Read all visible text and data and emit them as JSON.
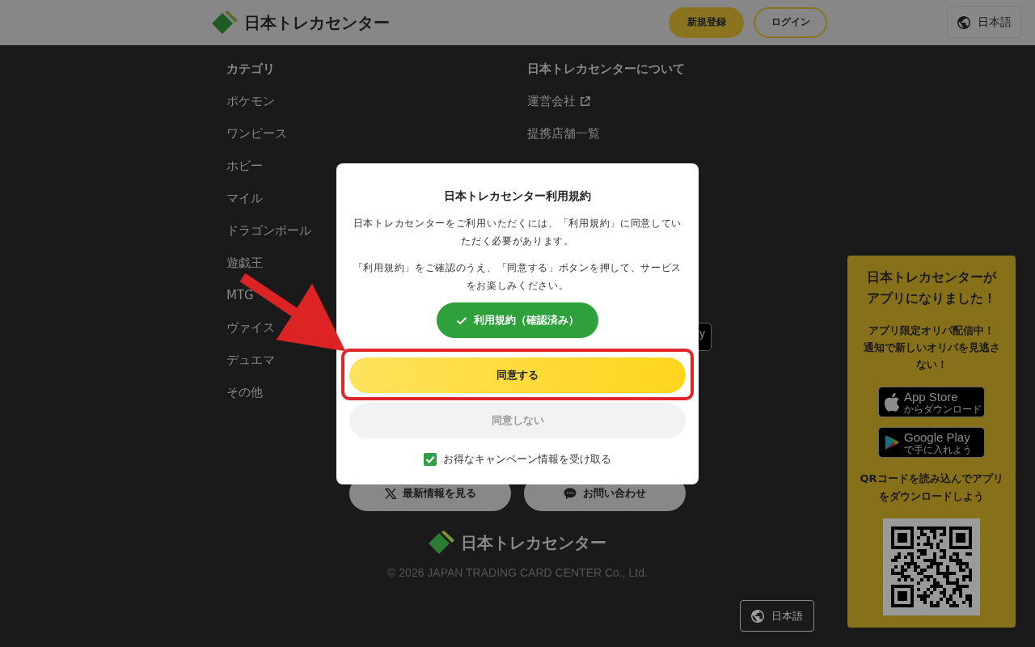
{
  "header": {
    "logo": {
      "text": "日本トレカセンター"
    },
    "buttons": [
      {
        "label": "新規登録",
        "kind": "primary"
      },
      {
        "label": "ログイン",
        "kind": "outline"
      }
    ],
    "language": "日本語"
  },
  "footer": {
    "columns": [
      {
        "title": "カテゴリ",
        "links": [
          {
            "label": "ポケモン",
            "external": false
          },
          {
            "label": "ワンピース",
            "external": false
          },
          {
            "label": "ホビー",
            "external": false
          },
          {
            "label": "マイル",
            "external": false
          },
          {
            "label": "ドラゴンボール",
            "external": false
          },
          {
            "label": "遊戯王",
            "external": false
          },
          {
            "label": "MTG",
            "external": false
          },
          {
            "label": "ヴァイス",
            "external": false
          },
          {
            "label": "デュエマ",
            "external": false
          },
          {
            "label": "その他",
            "external": false
          }
        ]
      },
      {
        "title": "日本トレカセンターについて",
        "links": [
          {
            "label": "運営会社",
            "external": true
          },
          {
            "label": "提携店舗一覧",
            "external": false
          }
        ]
      }
    ],
    "partial_store_badge": "y",
    "actions": [
      {
        "label": "最新情報を見る",
        "kind": "x"
      },
      {
        "label": "お問い合わせ",
        "kind": "chat"
      }
    ],
    "logo": {
      "text": "日本トレカセンター"
    },
    "copyright": "© 2026 JAPAN TRADING CARD CENTER Co., Ltd.",
    "language": "日本語"
  },
  "app_banner": {
    "title": "日本トレカセンターがアプリになりました！",
    "message": [
      "アプリ限定オリパ配信中！",
      "通知で新しいオリパを見逃さない！"
    ],
    "stores": [
      {
        "kind": "apple",
        "name": "App Store",
        "caption": "からダウンロード"
      },
      {
        "kind": "google",
        "name": "Google Play",
        "caption": "で手に入れよう"
      }
    ],
    "qr_caption": "QRコードを読み込んでアプリをダウンロードしよう"
  },
  "terms_dialog": {
    "title": "日本トレカセンター利用規約",
    "paragraphs": [
      "日本トレカセンターをご利用いただくには、「利用規約」に同意していただく必要があります。",
      "「利用規約」をご確認のうえ、「同意する」ボタンを押して、サービスをお楽しみください。"
    ],
    "terms_button": {
      "label": "利用規約（確認済み）",
      "checked": true
    },
    "buttons": [
      {
        "label": "同意する",
        "kind": "primary"
      },
      {
        "label": "同意しない",
        "kind": "secondary"
      }
    ],
    "newsletter": {
      "label": "お得なキャンペーン情報を受け取る",
      "checked": true
    }
  }
}
